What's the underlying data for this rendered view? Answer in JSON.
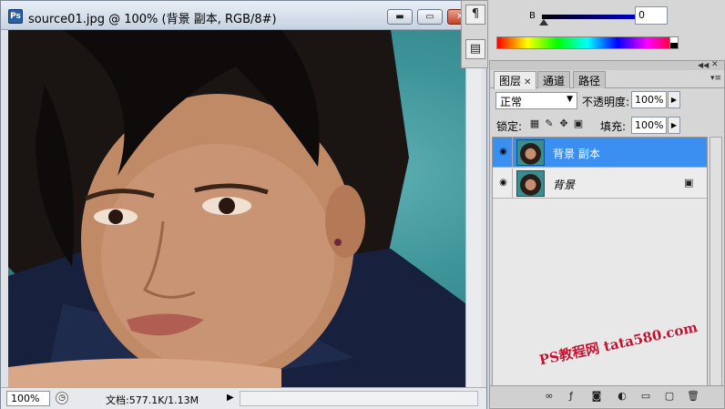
{
  "document": {
    "title": "source01.jpg @ 100% (背景 副本, RGB/8#)",
    "zoom": "100%",
    "info": "文档:577.1K/1.13M",
    "window_buttons": {
      "minimize": "▬",
      "restore": "▭",
      "close": "✕"
    }
  },
  "tools": {
    "paragraph": "¶",
    "notes": "▤"
  },
  "color": {
    "channel_label": "B",
    "value": "0"
  },
  "layers": {
    "tabs": [
      {
        "label": "图层",
        "active": true,
        "close": "✕"
      },
      {
        "label": "通道",
        "active": false
      },
      {
        "label": "路径",
        "active": false
      }
    ],
    "blend_mode": "正常",
    "opacity_label": "不透明度:",
    "opacity_value": "100%",
    "lock_label": "锁定:",
    "fill_label": "填充:",
    "fill_value": "100%",
    "items": [
      {
        "name": "背景 副本",
        "selected": true
      },
      {
        "name": "背景",
        "selected": false,
        "locked": true
      }
    ]
  },
  "watermark": "PS教程网 tata580.com",
  "icons": {
    "eye": "eye-icon",
    "lock_transparent": "lock-transparent-icon",
    "lock_paint": "brush-icon",
    "lock_move": "move-icon",
    "lock_all": "lock-icon"
  }
}
